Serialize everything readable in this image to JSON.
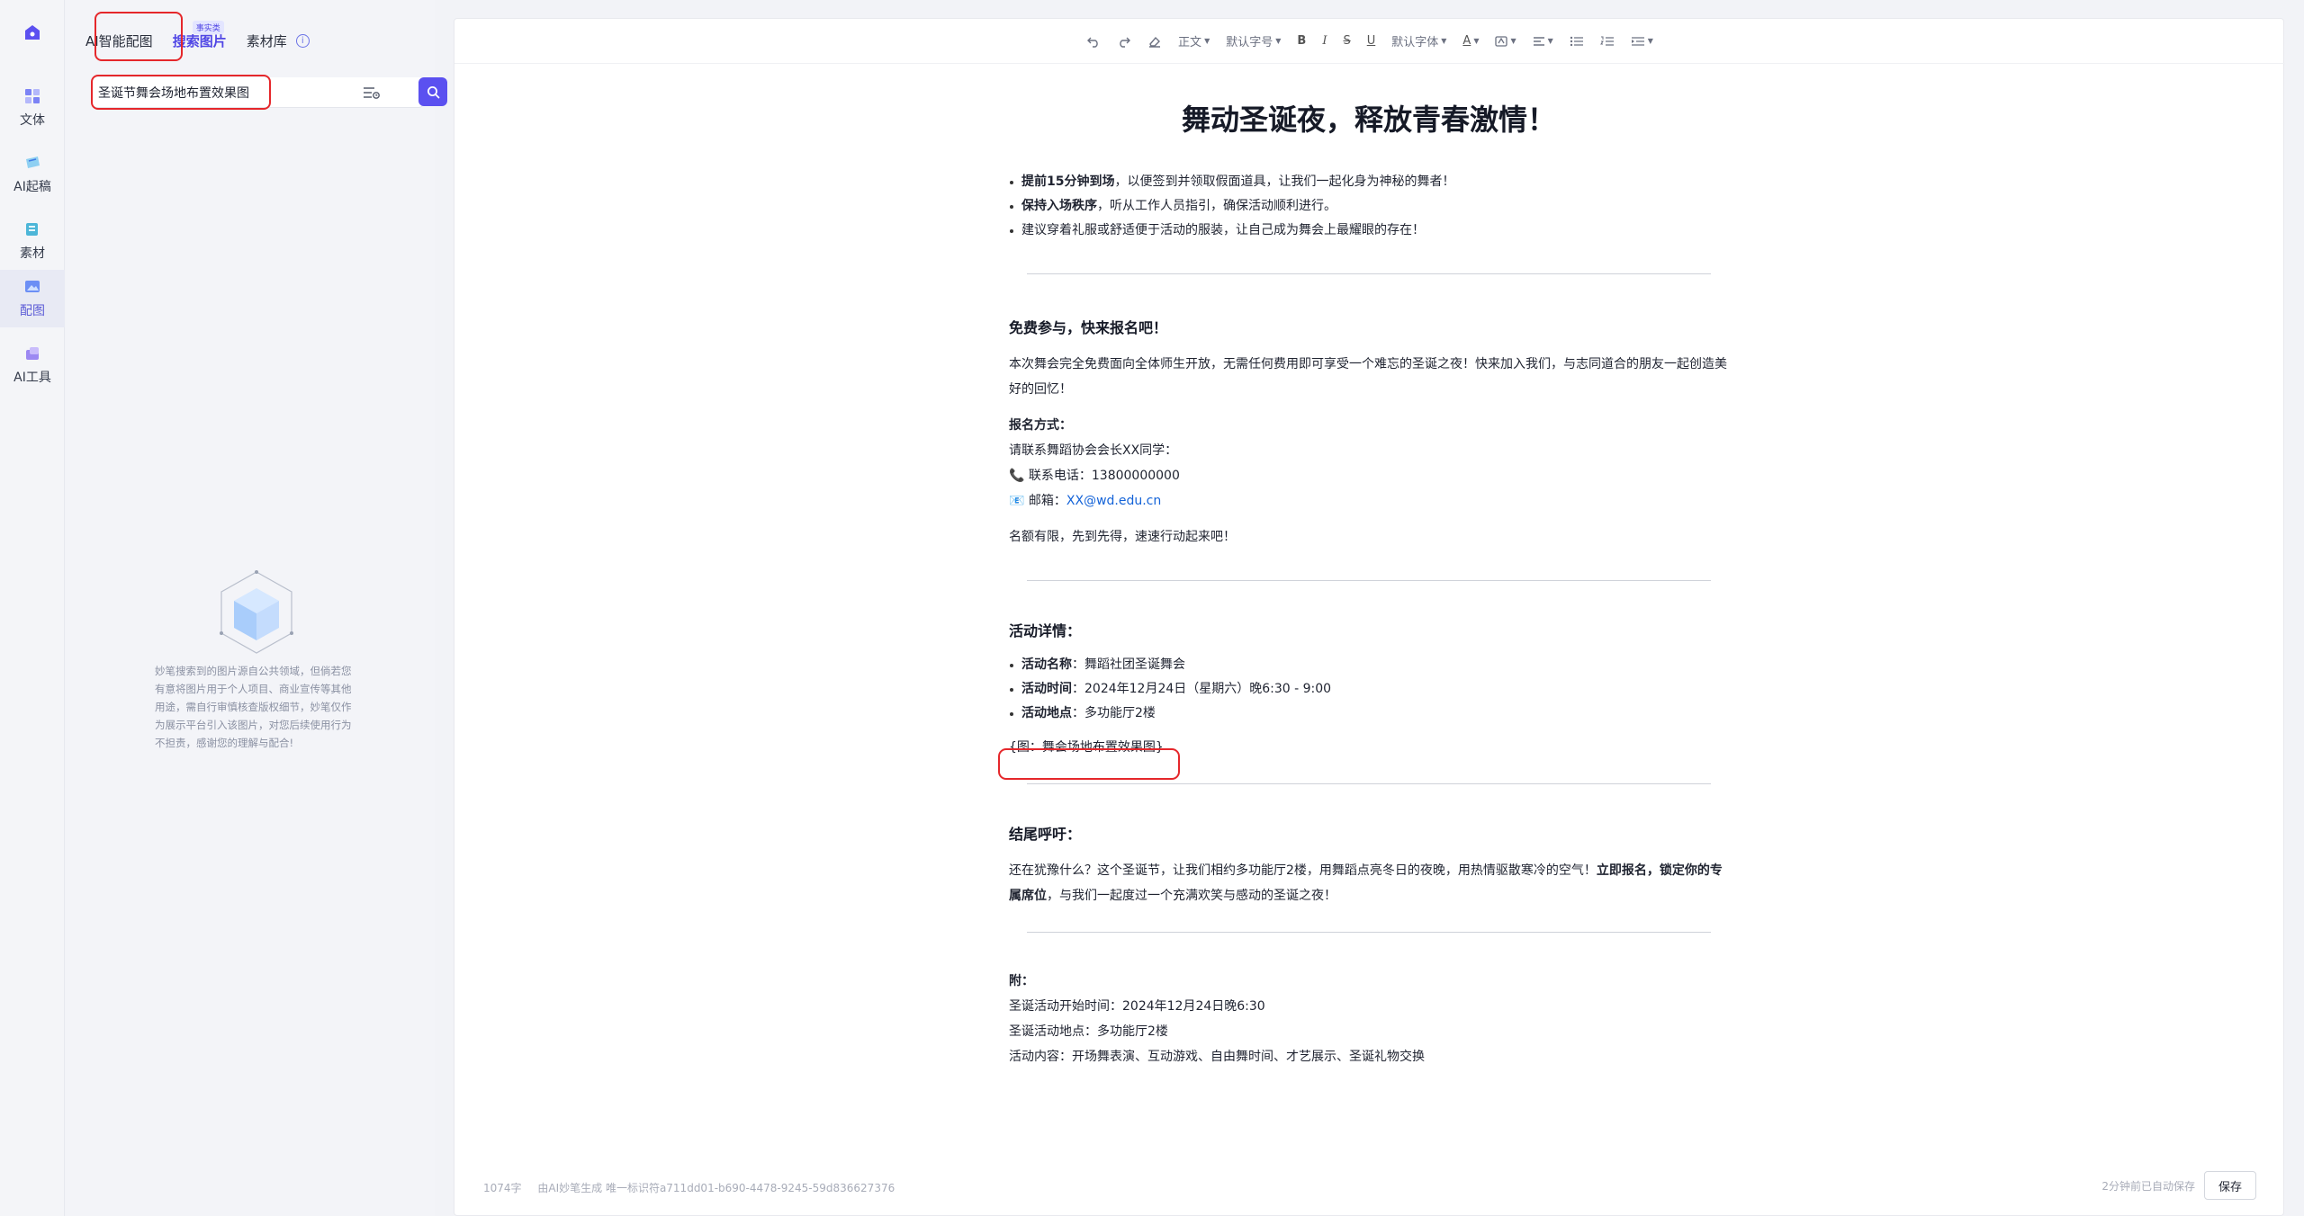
{
  "rail": {
    "items": [
      {
        "label": "文体",
        "icon": "text-style-icon"
      },
      {
        "label": "AI起稿",
        "icon": "ai-draft-icon"
      },
      {
        "label": "素材",
        "icon": "material-icon"
      },
      {
        "label": "配图",
        "icon": "image-icon",
        "active": true
      },
      {
        "label": "AI工具",
        "icon": "ai-tools-icon"
      }
    ]
  },
  "panel": {
    "tabs": [
      {
        "label": "AI智能配图"
      },
      {
        "label": "搜索图片",
        "badge": "事实类",
        "active": true
      },
      {
        "label": "素材库"
      }
    ],
    "search": {
      "value": "圣诞节舞会场地布置效果图"
    },
    "empty_note": "妙笔搜索到的图片源自公共领域，但倘若您有意将图片用于个人项目、商业宣传等其他用途，需自行审慎核查版权细节，妙笔仅作为展示平台引入该图片，对您后续使用行为不担责，感谢您的理解与配合!"
  },
  "toolbar": {
    "paragraph_style": "正文",
    "font_size": "默认字号",
    "font_family": "默认字体",
    "text_color": "A"
  },
  "doc": {
    "title": "舞动圣诞夜，释放青春激情！",
    "intro_bullets": [
      {
        "bold": "提前15分钟到场",
        "text": "，以便签到并领取假面道具，让我们一起化身为神秘的舞者！"
      },
      {
        "bold": "保持入场秩序",
        "text": "，听从工作人员指引，确保活动顺利进行。"
      },
      {
        "bold": "",
        "text": "建议穿着礼服或舒适便于活动的服装，让自己成为舞会上最耀眼的存在！"
      }
    ],
    "section1": {
      "heading": "免费参与，快来报名吧！",
      "para": "本次舞会完全免费面向全体师生开放，无需任何费用即可享受一个难忘的圣诞之夜！快来加入我们，与志同道合的朋友一起创造美好的回忆！",
      "signup_label": "报名方式：",
      "contact_line": "请联系舞蹈协会会长XX同学：",
      "phone_icon": "📞",
      "phone_label": "联系电话：",
      "phone": "13800000000",
      "email_icon": "📧",
      "email_label": "邮箱：",
      "email": "XX@wd.edu.cn",
      "closing": "名额有限，先到先得，速速行动起来吧！"
    },
    "section2": {
      "heading": "活动详情：",
      "details": [
        {
          "label": "活动名称",
          "value": "：舞蹈社团圣诞舞会"
        },
        {
          "label": "活动时间",
          "value": "：2024年12月24日（星期六）晚6:30 - 9:00"
        },
        {
          "label": "活动地点",
          "value": "：多功能厅2楼"
        }
      ],
      "figure_ref": "{图：舞会场地布置效果图}"
    },
    "section3": {
      "heading": "结尾呼吁：",
      "para_a": "还在犹豫什么？这个圣诞节，让我们相约多功能厅2楼，用舞蹈点亮冬日的夜晚，用热情驱散寒冷的空气！",
      "para_bold_1": "立即报名，锁定你的专",
      "para_bold_2": "属席位",
      "para_b": "，与我们一起度过一个充满欢笑与感动的圣诞之夜！"
    },
    "appendix": {
      "heading": "附：",
      "lines": [
        "圣诞活动开始时间：2024年12月24日晚6:30",
        "圣诞活动地点：多功能厅2楼",
        "活动内容：开场舞表演、互动游戏、自由舞时间、才艺展示、圣诞礼物交换"
      ]
    }
  },
  "footer": {
    "word_count": "1074字",
    "ai_note": "由AI妙笔生成 唯一标识符a711dd01-b690-4478-9245-59d836627376",
    "autosave": "2分钟前已自动保存",
    "save_label": "保存"
  },
  "colors": {
    "accent": "#5b50f0",
    "highlight": "#e5272b",
    "link": "#1463d8"
  }
}
